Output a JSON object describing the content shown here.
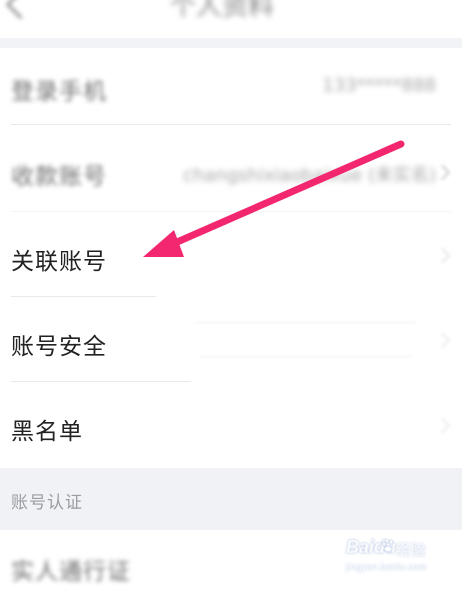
{
  "header": {
    "title": "个人资料"
  },
  "rows": [
    {
      "label": "登录手机",
      "value": "133*****888"
    },
    {
      "label": "收款账号",
      "value": "changshixiaobaixue (未实名)"
    },
    {
      "label": "关联账号",
      "value": ""
    },
    {
      "label": "账号安全",
      "value": ""
    },
    {
      "label": "黑名单",
      "value": ""
    }
  ],
  "section": {
    "title": "账号认证"
  },
  "bottom_row": {
    "label": "实人通行证"
  },
  "watermark": {
    "brand": "Baidu",
    "brand_cn": "经验",
    "sub": "jingyan.baidu.com"
  },
  "colors": {
    "arrow": "#f2276f",
    "background": "#ffffff",
    "section_bg": "#f1f2f6"
  },
  "icons": {
    "back": "chevron-left-icon",
    "row_chevron": "chevron-right-icon",
    "annotation": "pointer-arrow-icon"
  }
}
